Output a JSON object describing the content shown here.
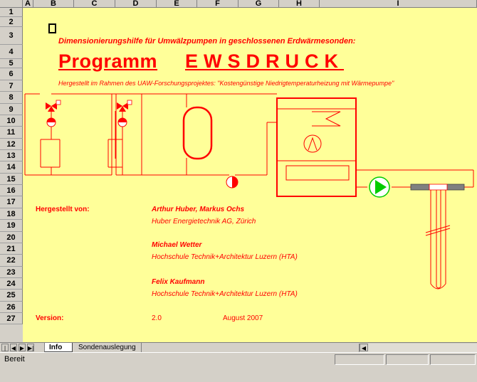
{
  "columns": [
    "A",
    "B",
    "C",
    "D",
    "E",
    "F",
    "G",
    "H",
    "I"
  ],
  "rows": [
    "1",
    "2",
    "3",
    "4",
    "5",
    "6",
    "7",
    "8",
    "9",
    "10",
    "11",
    "12",
    "13",
    "14",
    "15",
    "16",
    "17",
    "18",
    "19",
    "20",
    "21",
    "22",
    "23",
    "24",
    "25",
    "26",
    "27"
  ],
  "sheet": {
    "subtitle": "Dimensionierungshilfe für Umwälzpumpen in geschlossenen Erdwärmesonden:",
    "program_word": "Programm",
    "program_name": "EWSDRUCK",
    "note": "Hergestellt im Rahmen des UAW-Forschungsprojektes: \"Kostengünstige Niedrigtemperaturheizung mit Wärmepumpe\"",
    "made_by_label": "Hergestellt von:",
    "author1_names": "Arthur Huber, Markus Ochs",
    "author1_org": "Huber Energietechnik AG, Zürich",
    "author2_name": "Michael Wetter",
    "author2_org": "Hochschule Technik+Architektur Luzern (HTA)",
    "author3_name": "Felix Kaufmann",
    "author3_org": "Hochschule Technik+Architektur Luzern (HTA)",
    "version_label": "Version:",
    "version_value": "2.0",
    "version_date": "August 2007"
  },
  "tabs": {
    "info": "Info",
    "sonde": "Sondenauslegung"
  },
  "tab_nav": {
    "first": "|◀",
    "prev": "◀",
    "next": "▶",
    "last": "▶|"
  },
  "status": {
    "text": "Bereit"
  },
  "colors": {
    "accent": "#ff0000",
    "sheet_bg": "#ffff99",
    "pump_green": "#00cc00"
  }
}
